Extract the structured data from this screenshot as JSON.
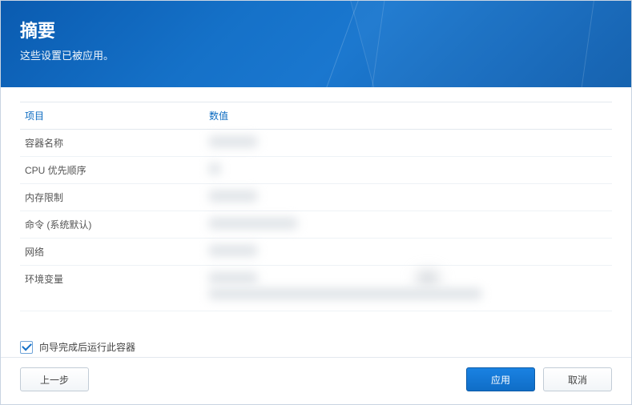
{
  "banner": {
    "title": "摘要",
    "subtitle": "这些设置已被应用。"
  },
  "table": {
    "headers": {
      "item": "项目",
      "value": "数值"
    },
    "rows": [
      {
        "item": "容器名称"
      },
      {
        "item": "CPU 优先顺序"
      },
      {
        "item": "内存限制"
      },
      {
        "item": "命令 (系统默认)"
      },
      {
        "item": "网络"
      },
      {
        "item": "环境变量"
      }
    ]
  },
  "checkbox": {
    "run_after_wizard": "向导完成后运行此容器",
    "checked": true
  },
  "buttons": {
    "back": "上一步",
    "apply": "应用",
    "cancel": "取消"
  }
}
